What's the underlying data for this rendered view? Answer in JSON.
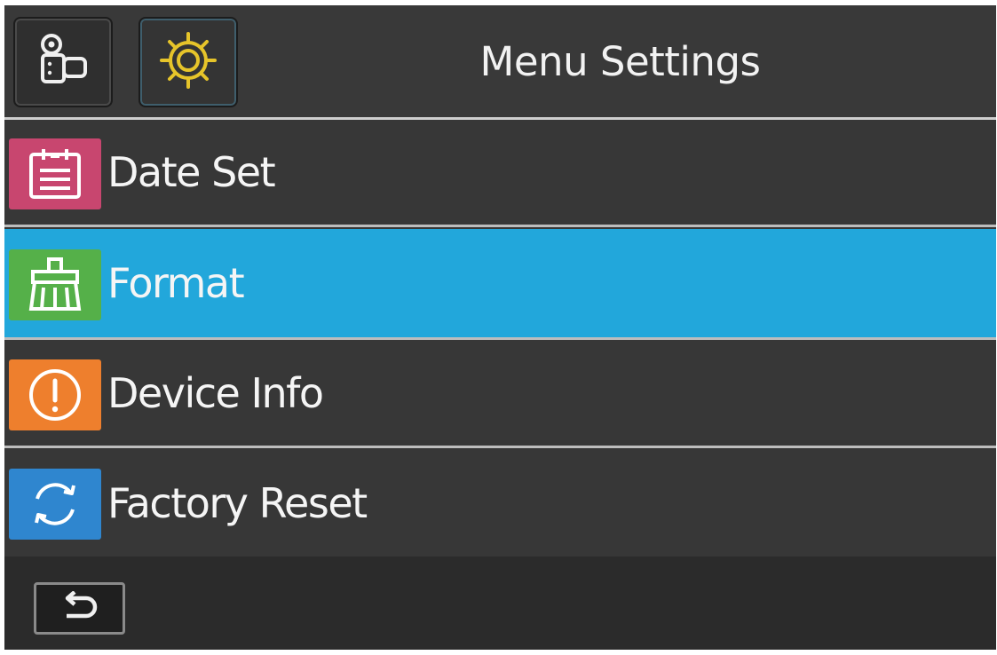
{
  "header": {
    "title": "Menu Settings",
    "tabs": [
      {
        "icon": "video-camera-icon",
        "state": "inactive"
      },
      {
        "icon": "gear-icon",
        "state": "active",
        "icon_color": "#e6c42a"
      }
    ]
  },
  "menu": {
    "items": [
      {
        "label": "Date Set",
        "icon": "calendar-icon",
        "icon_color": "#c8466f",
        "selected": false
      },
      {
        "label": "Format",
        "icon": "broom-icon",
        "icon_color": "#55b049",
        "selected": true
      },
      {
        "label": "Device Info",
        "icon": "info-alert-icon",
        "icon_color": "#ee7f2d",
        "selected": false
      },
      {
        "label": "Factory Reset",
        "icon": "reset-icon",
        "icon_color": "#2f86cf",
        "selected": false
      }
    ]
  },
  "footer": {
    "back_icon": "back-arrow-icon"
  },
  "colors": {
    "background": "#373737",
    "selected": "#22a7db",
    "separator": "#cfcfcf"
  }
}
